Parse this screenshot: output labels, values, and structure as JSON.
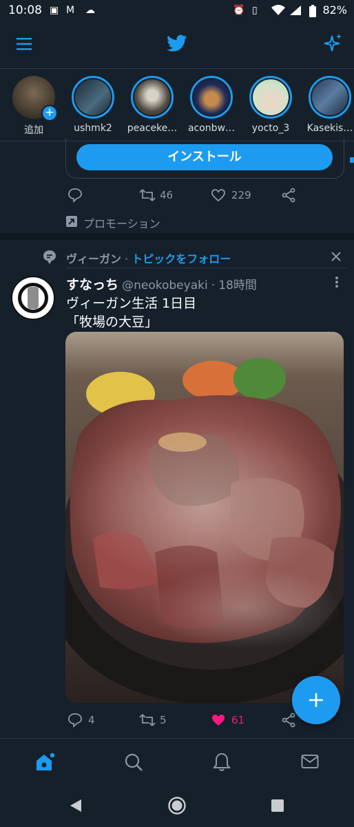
{
  "status_bar": {
    "time": "10:08",
    "battery": "82%"
  },
  "header": {
    "menu_icon": "hamburger-menu-icon",
    "logo_icon": "twitter-bird-icon",
    "sparkle_icon": "sparkle-icon"
  },
  "fleets": [
    {
      "label": "追加"
    },
    {
      "label": "ushmk2"
    },
    {
      "label": "peaceke…"
    },
    {
      "label": "aconbw…"
    },
    {
      "label": "yocto_3"
    },
    {
      "label": "Kasekis…"
    }
  ],
  "promo": {
    "install_label": "インストール",
    "replies": "",
    "retweets": "46",
    "likes": "229",
    "promotion_label": "プロモーション"
  },
  "tweet": {
    "topic": "ヴィーガン",
    "topic_sep": "·",
    "follow_topic": "トピックをフォロー",
    "author_name": "すなっち",
    "handle": "@neokobeyaki",
    "time_sep": "·",
    "time": "18時間",
    "text_line1": "ヴィーガン生活 1日目",
    "text_line2": "「牧場の大豆」",
    "replies": "4",
    "retweets": "5",
    "likes": "61"
  },
  "colors": {
    "accent": "#1d9bf0",
    "background": "#15202b",
    "like": "#f91880",
    "muted": "#8b98a5"
  }
}
